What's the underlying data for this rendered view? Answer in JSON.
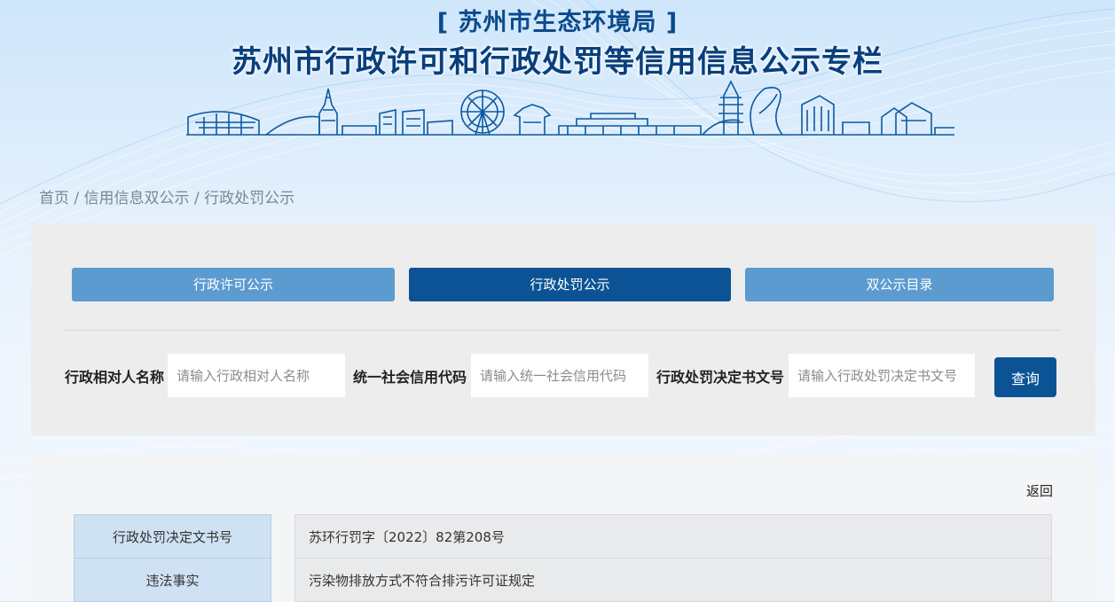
{
  "header": {
    "org_name": "[ 苏州市生态环境局 ]",
    "title": "苏州市行政许可和行政处罚等信用信息公示专栏"
  },
  "breadcrumb": {
    "items": [
      "首页",
      "信用信息双公示",
      "行政处罚公示"
    ],
    "separator": " / "
  },
  "tabs": [
    {
      "label": "行政许可公示",
      "active": false
    },
    {
      "label": "行政处罚公示",
      "active": true
    },
    {
      "label": "双公示目录",
      "active": false
    }
  ],
  "search": {
    "fields": [
      {
        "label": "行政相对人名称",
        "placeholder": "请输入行政相对人名称",
        "value": ""
      },
      {
        "label": "统一社会信用代码",
        "placeholder": "请输入统一社会信用代码",
        "value": ""
      },
      {
        "label": "行政处罚决定书文号",
        "placeholder": "请输入行政处罚决定书文号",
        "value": ""
      }
    ],
    "button_label": "查询"
  },
  "detail": {
    "back_label": "返回",
    "rows": [
      {
        "key": "行政处罚决定文书号",
        "value": "苏环行罚字〔2022〕82第208号"
      },
      {
        "key": "违法事实",
        "value": "污染物排放方式不符合排污许可证规定"
      }
    ]
  },
  "colors": {
    "primary": "#0b5394",
    "tab_inactive": "#5c9bd0",
    "title": "#083f7d",
    "key_cell": "#cfe2f3"
  }
}
